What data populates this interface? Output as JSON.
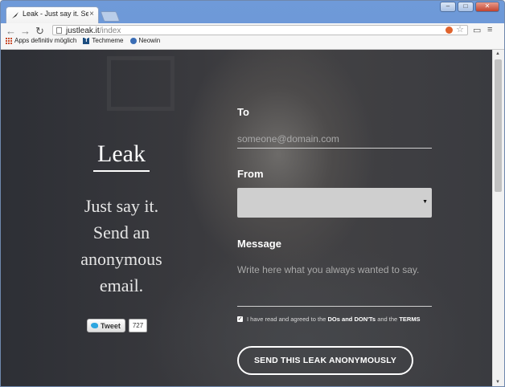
{
  "browser": {
    "tab_title": "Leak - Just say it. Send an",
    "url_host": "justleak.it",
    "url_path": "/index",
    "bookmarks": [
      "Apps definitiv möglich",
      "Techmeme",
      "Neowin"
    ]
  },
  "page": {
    "logo": "Leak",
    "tagline": "Just say it. Send an anonymous email.",
    "tweet_label": "Tweet",
    "tweet_count": "727",
    "form": {
      "to_label": "To",
      "to_placeholder": "someone@domain.com",
      "from_label": "From",
      "message_label": "Message",
      "message_placeholder": "Write here what you always wanted to say.",
      "agree_prefix": "I have read and agreed to the",
      "agree_link1": "DOs and DON'Ts",
      "agree_mid": "and the",
      "agree_link2": "TERMS",
      "send_label": "SEND THIS LEAK ANONYMOUSLY",
      "agree_checked": true
    }
  },
  "colors": {
    "chrome_blue": "#6f9ad9",
    "page_dark": "#3a3a3e",
    "select_grey": "#cfcfcf"
  }
}
